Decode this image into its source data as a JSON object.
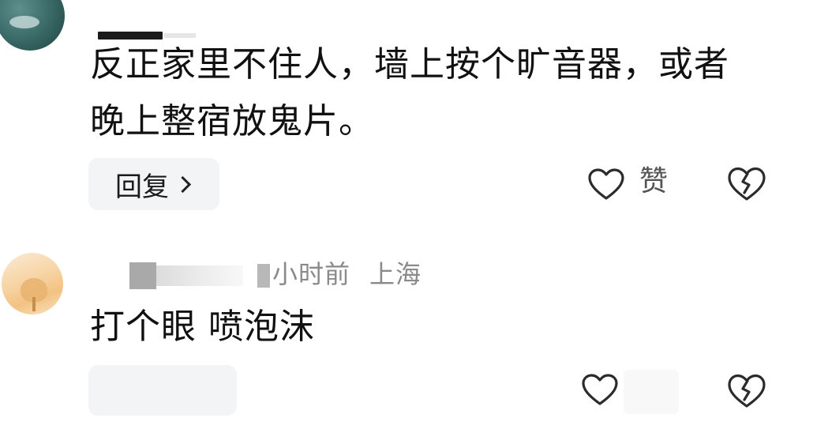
{
  "comments": [
    {
      "text_line1": "反正家里不住人，墙上按个旷音器，或者",
      "text_line2": "晚上整宿放鬼片。",
      "reply_label": "回复",
      "like_label": "赞"
    },
    {
      "time": "小时前",
      "location": "上海",
      "text_line1": "打个眼 喷泡沫"
    }
  ],
  "icons": {
    "like": "heart-outline-icon",
    "dislike": "broken-heart-icon",
    "reply_chevron": "chevron-right-icon"
  }
}
